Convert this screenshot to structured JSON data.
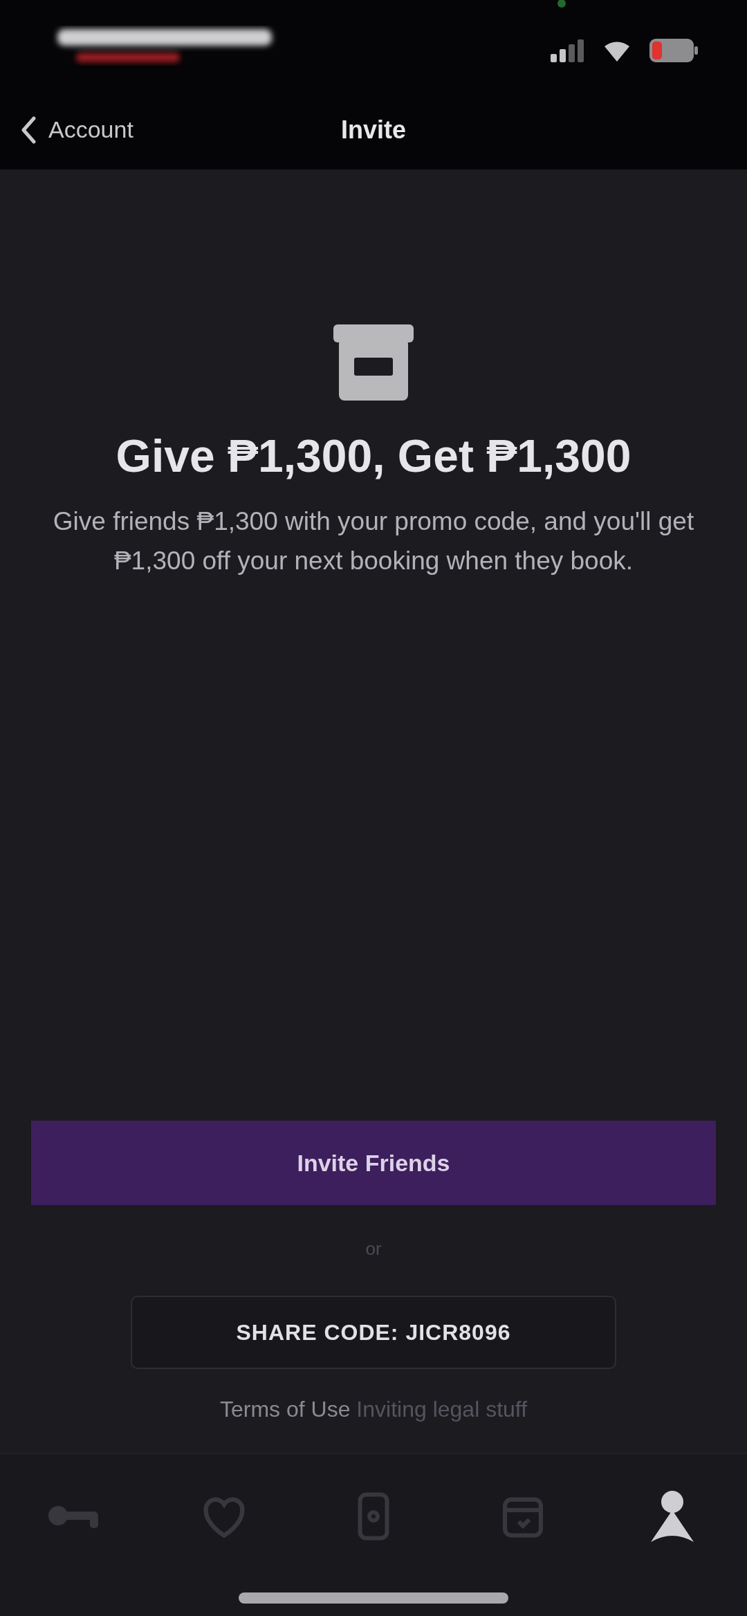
{
  "nav": {
    "back_label": "Account",
    "title": "Invite"
  },
  "promo": {
    "heading": "Give ₱1,300, Get ₱1,300",
    "description": "Give friends ₱1,300 with your promo code, and you'll get ₱1,300 off your next booking when they book."
  },
  "invite_button": {
    "label": "Invite Friends"
  },
  "separator": "or",
  "share_code_button": {
    "label": "SHARE CODE: JICR8096"
  },
  "terms": {
    "text": "Terms of Use",
    "link": "Inviting legal stuff"
  },
  "tab_bar": {
    "tabs": [
      {
        "kind": "key",
        "selected": false
      },
      {
        "kind": "heart",
        "selected": false
      },
      {
        "kind": "phone",
        "selected": false
      },
      {
        "kind": "calendar",
        "selected": false
      },
      {
        "kind": "person",
        "selected": true
      }
    ]
  }
}
